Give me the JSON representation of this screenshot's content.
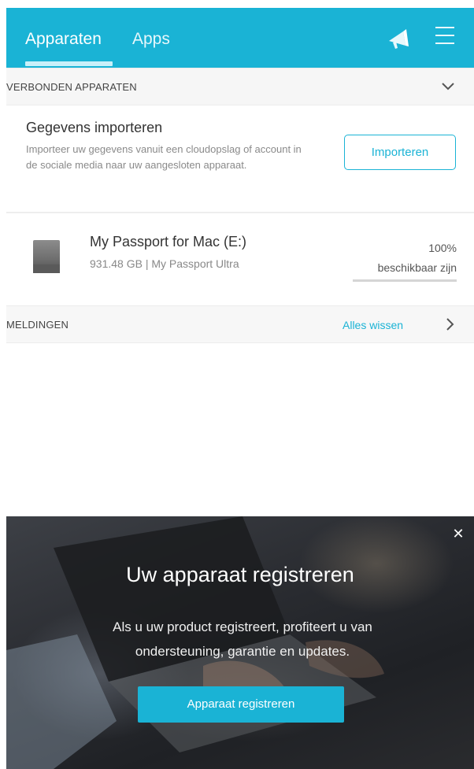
{
  "header": {
    "tabs": [
      {
        "label": "Apparaten",
        "active": true
      },
      {
        "label": "Apps",
        "active": false
      }
    ],
    "icons": [
      "megaphone-icon",
      "hamburger-menu-icon"
    ],
    "accent_color": "#1ab3d5"
  },
  "connected_section": {
    "title": "VERBONDEN APPARATEN",
    "icon": "chevron-down-icon"
  },
  "import": {
    "title": "Gegevens importeren",
    "description": "Importeer uw gegevens vanuit een cloudopslag of account in de sociale media naar uw aangesloten apparaat.",
    "button_label": "Importeren"
  },
  "device": {
    "name": "My Passport for Mac (E:)",
    "details": "931.48 GB | My Passport Ultra",
    "percent": "100%",
    "status": "beschikbaar zijn",
    "icon": "hard-drive-icon"
  },
  "notifications_section": {
    "title": "MELDINGEN",
    "clear_label": "Alles wissen",
    "icon": "chevron-right-icon"
  },
  "banner": {
    "title": "Uw apparaat registreren",
    "text": "Als u uw product registreert, profiteert u van ondersteuning, garantie en updates.",
    "button_label": "Apparaat registreren",
    "close_icon": "close-icon"
  }
}
